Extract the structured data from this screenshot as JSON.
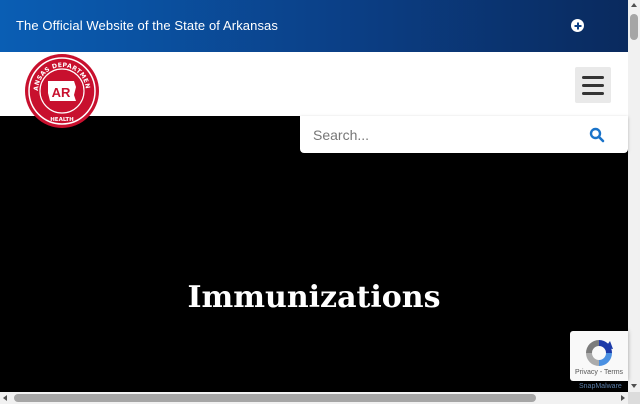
{
  "banner": {
    "text": "The Official Website of the State of Arkansas",
    "expand_icon": "plus-circle-icon"
  },
  "header": {
    "logo": {
      "ring_text": "ARKANSAS DEPARTMENT OF",
      "center_text": "AR",
      "bottom_text": "HEALTH",
      "color": "#c8102e"
    },
    "menu_icon": "hamburger-icon"
  },
  "search": {
    "placeholder": "Search...",
    "icon": "search-icon",
    "icon_color": "#1a73c9"
  },
  "hero": {
    "title": "Immunizations",
    "background": "#000000"
  },
  "recaptcha": {
    "links": "Privacy - Terms"
  },
  "watermark": {
    "text": "SnapMalware"
  },
  "colors": {
    "banner_start": "#0a5eb4",
    "banner_end": "#0a2a5e",
    "brand_red": "#c8102e"
  }
}
